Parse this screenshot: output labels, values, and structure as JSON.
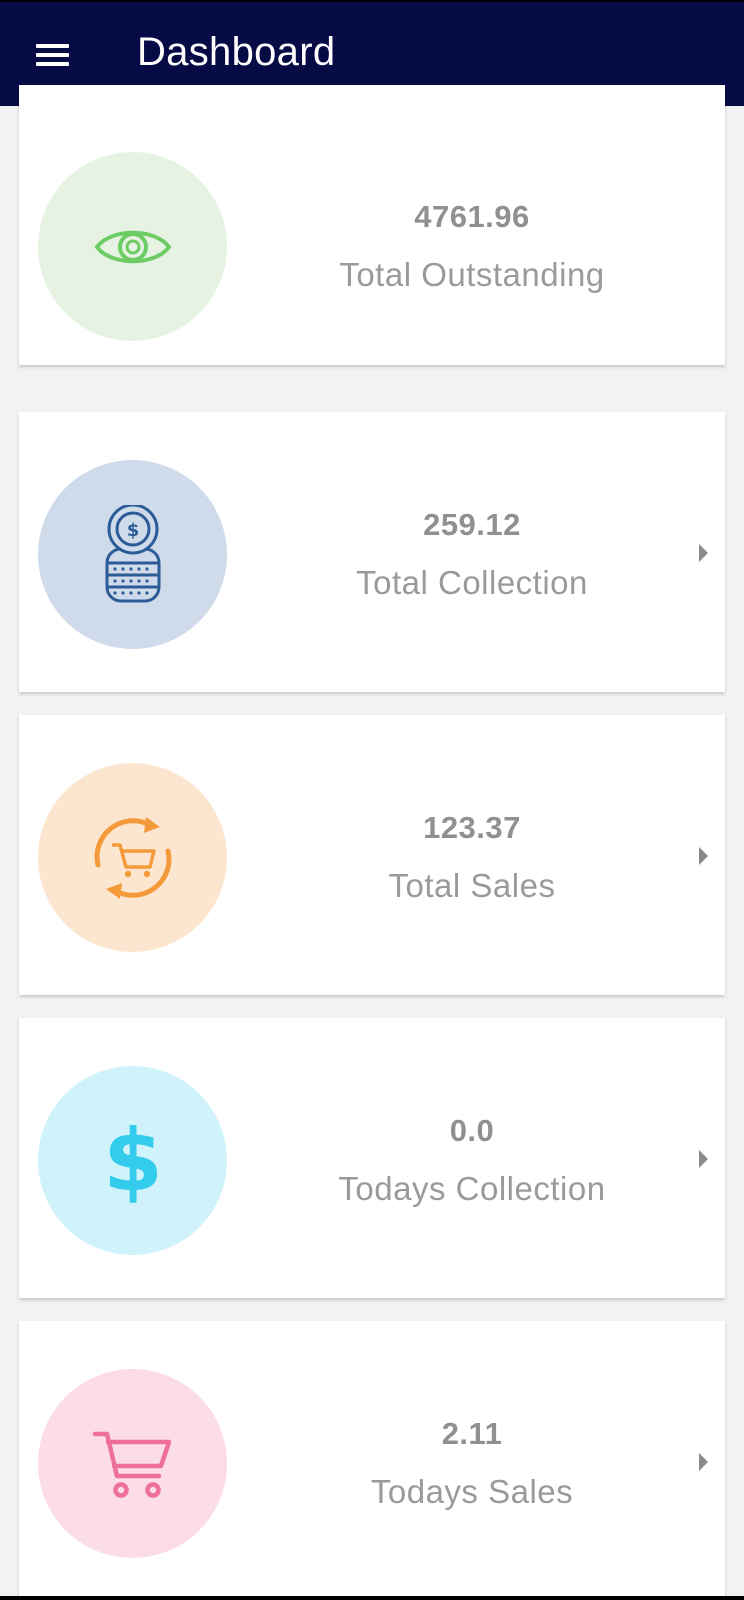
{
  "header": {
    "title": "Dashboard",
    "menu_icon": "hamburger-menu-icon",
    "background": "#070b45"
  },
  "cards": [
    {
      "value": "4761.96",
      "label": "Total Outstanding",
      "icon": "eye-icon",
      "circle_color": "#e6f3e3",
      "icon_color": "#6dcc63",
      "has_chevron": false
    },
    {
      "value": "259.12",
      "label": "Total Collection",
      "icon": "coin-stack-icon",
      "circle_color": "#cfdbea",
      "icon_color": "#2c5c98",
      "has_chevron": true
    },
    {
      "value": "123.37",
      "label": "Total Sales",
      "icon": "cart-refresh-icon",
      "circle_color": "#fde6d0",
      "icon_color": "#f59a3a",
      "has_chevron": true
    },
    {
      "value": "0.0",
      "label": "Todays Collection",
      "icon": "dollar-icon",
      "circle_color": "#d0f3fb",
      "icon_color": "#33ccec",
      "has_chevron": true
    },
    {
      "value": "2.11",
      "label": "Todays Sales",
      "icon": "shopping-cart-icon",
      "circle_color": "#fcdce8",
      "icon_color": "#ee6f9c",
      "has_chevron": true
    }
  ]
}
